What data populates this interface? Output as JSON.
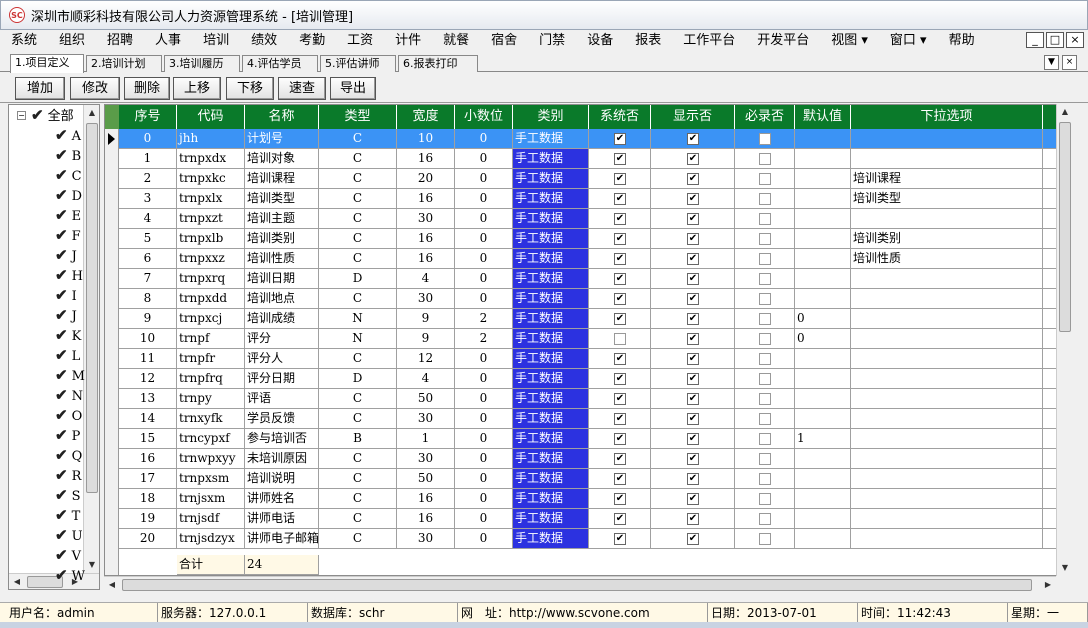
{
  "window": {
    "title": "深圳市顺彩科技有限公司人力资源管理系统 - [培训管理]",
    "icon": "app-logo-icon",
    "mdi_controls": [
      "_",
      "□",
      "×"
    ]
  },
  "menu": [
    "系统",
    "组织",
    "招聘",
    "人事",
    "培训",
    "绩效",
    "考勤",
    "工资",
    "计件",
    "就餐",
    "宿舍",
    "门禁",
    "设备",
    "报表",
    "工作平台",
    "开发平台",
    "视图 ▾",
    "窗口 ▾",
    "帮助"
  ],
  "tabs": [
    "1.项目定义",
    "2.培训计划",
    "3.培训履历",
    "4.评估学员",
    "5.评估讲师",
    "6.报表打印"
  ],
  "tab_ctrls": [
    "▼",
    "×"
  ],
  "toolbar": [
    "增加",
    "修改",
    "删除",
    "上移",
    "下移",
    "速查",
    "导出"
  ],
  "tree": {
    "root": "全部",
    "items": [
      "A",
      "B",
      "C",
      "D",
      "E",
      "F",
      "J",
      "H",
      "I",
      "J",
      "K",
      "L",
      "M",
      "N",
      "O",
      "P",
      "Q",
      "R",
      "S",
      "T",
      "U",
      "V",
      "W"
    ],
    "expander": "−"
  },
  "grid": {
    "columns": [
      "序号",
      "代码",
      "名称",
      "类型",
      "宽度",
      "小数位",
      "类别",
      "系统否",
      "显示否",
      "必录否",
      "默认值",
      "下拉选项"
    ],
    "rows": [
      {
        "no": "0",
        "code": "jhh",
        "name": "计划号",
        "type": "C",
        "width": "10",
        "dec": "0",
        "cat": "手工数据",
        "sys": true,
        "show": true,
        "req": false,
        "def": "",
        "opt": ""
      },
      {
        "no": "1",
        "code": "trnpxdx",
        "name": "培训对象",
        "type": "C",
        "width": "16",
        "dec": "0",
        "cat": "手工数据",
        "sys": true,
        "show": true,
        "req": false,
        "def": "",
        "opt": ""
      },
      {
        "no": "2",
        "code": "trnpxkc",
        "name": "培训课程",
        "type": "C",
        "width": "20",
        "dec": "0",
        "cat": "手工数据",
        "sys": true,
        "show": true,
        "req": false,
        "def": "",
        "opt": "培训课程"
      },
      {
        "no": "3",
        "code": "trnpxlx",
        "name": "培训类型",
        "type": "C",
        "width": "16",
        "dec": "0",
        "cat": "手工数据",
        "sys": true,
        "show": true,
        "req": false,
        "def": "",
        "opt": "培训类型"
      },
      {
        "no": "4",
        "code": "trnpxzt",
        "name": "培训主题",
        "type": "C",
        "width": "30",
        "dec": "0",
        "cat": "手工数据",
        "sys": true,
        "show": true,
        "req": false,
        "def": "",
        "opt": ""
      },
      {
        "no": "5",
        "code": "trnpxlb",
        "name": "培训类别",
        "type": "C",
        "width": "16",
        "dec": "0",
        "cat": "手工数据",
        "sys": true,
        "show": true,
        "req": false,
        "def": "",
        "opt": "培训类别"
      },
      {
        "no": "6",
        "code": "trnpxxz",
        "name": "培训性质",
        "type": "C",
        "width": "16",
        "dec": "0",
        "cat": "手工数据",
        "sys": true,
        "show": true,
        "req": false,
        "def": "",
        "opt": "培训性质"
      },
      {
        "no": "7",
        "code": "trnpxrq",
        "name": "培训日期",
        "type": "D",
        "width": "4",
        "dec": "0",
        "cat": "手工数据",
        "sys": true,
        "show": true,
        "req": false,
        "def": "",
        "opt": ""
      },
      {
        "no": "8",
        "code": "trnpxdd",
        "name": "培训地点",
        "type": "C",
        "width": "30",
        "dec": "0",
        "cat": "手工数据",
        "sys": true,
        "show": true,
        "req": false,
        "def": "",
        "opt": ""
      },
      {
        "no": "9",
        "code": "trnpxcj",
        "name": "培训成绩",
        "type": "N",
        "width": "9",
        "dec": "2",
        "cat": "手工数据",
        "sys": true,
        "show": true,
        "req": false,
        "def": "0",
        "opt": ""
      },
      {
        "no": "10",
        "code": "trnpf",
        "name": "评分",
        "type": "N",
        "width": "9",
        "dec": "2",
        "cat": "手工数据",
        "sys": false,
        "show": true,
        "req": false,
        "def": "0",
        "opt": ""
      },
      {
        "no": "11",
        "code": "trnpfr",
        "name": "评分人",
        "type": "C",
        "width": "12",
        "dec": "0",
        "cat": "手工数据",
        "sys": true,
        "show": true,
        "req": false,
        "def": "",
        "opt": ""
      },
      {
        "no": "12",
        "code": "trnpfrq",
        "name": "评分日期",
        "type": "D",
        "width": "4",
        "dec": "0",
        "cat": "手工数据",
        "sys": true,
        "show": true,
        "req": false,
        "def": "",
        "opt": ""
      },
      {
        "no": "13",
        "code": "trnpy",
        "name": "评语",
        "type": "C",
        "width": "50",
        "dec": "0",
        "cat": "手工数据",
        "sys": true,
        "show": true,
        "req": false,
        "def": "",
        "opt": ""
      },
      {
        "no": "14",
        "code": "trnxyfk",
        "name": "学员反馈",
        "type": "C",
        "width": "30",
        "dec": "0",
        "cat": "手工数据",
        "sys": true,
        "show": true,
        "req": false,
        "def": "",
        "opt": ""
      },
      {
        "no": "15",
        "code": "trncypxf",
        "name": "参与培训否",
        "type": "B",
        "width": "1",
        "dec": "0",
        "cat": "手工数据",
        "sys": true,
        "show": true,
        "req": false,
        "def": "1",
        "opt": ""
      },
      {
        "no": "16",
        "code": "trnwpxyy",
        "name": "未培训原因",
        "type": "C",
        "width": "30",
        "dec": "0",
        "cat": "手工数据",
        "sys": true,
        "show": true,
        "req": false,
        "def": "",
        "opt": ""
      },
      {
        "no": "17",
        "code": "trnpxsm",
        "name": "培训说明",
        "type": "C",
        "width": "50",
        "dec": "0",
        "cat": "手工数据",
        "sys": true,
        "show": true,
        "req": false,
        "def": "",
        "opt": ""
      },
      {
        "no": "18",
        "code": "trnjsxm",
        "name": "讲师姓名",
        "type": "C",
        "width": "16",
        "dec": "0",
        "cat": "手工数据",
        "sys": true,
        "show": true,
        "req": false,
        "def": "",
        "opt": ""
      },
      {
        "no": "19",
        "code": "trnjsdf",
        "name": "讲师电话",
        "type": "C",
        "width": "16",
        "dec": "0",
        "cat": "手工数据",
        "sys": true,
        "show": true,
        "req": false,
        "def": "",
        "opt": ""
      },
      {
        "no": "20",
        "code": "trnjsdzyx",
        "name": "讲师电子邮箱",
        "type": "C",
        "width": "30",
        "dec": "0",
        "cat": "手工数据",
        "sys": true,
        "show": true,
        "req": false,
        "def": "",
        "opt": ""
      }
    ],
    "footer": {
      "label": "合计",
      "count": "24"
    },
    "check_glyph": "✔"
  },
  "status": [
    "用户名：admin",
    "服务器：127.0.0.1",
    "数据库：schr",
    "网　址：http://www.scvone.com",
    "日期：2013-07-01",
    "时间：11:42:43",
    "星期：一"
  ],
  "colors": {
    "header": "#0a7a2a",
    "selection": "#3b93f5",
    "code_blue": "#2c32e0",
    "status_bg": "#fff9e6"
  }
}
